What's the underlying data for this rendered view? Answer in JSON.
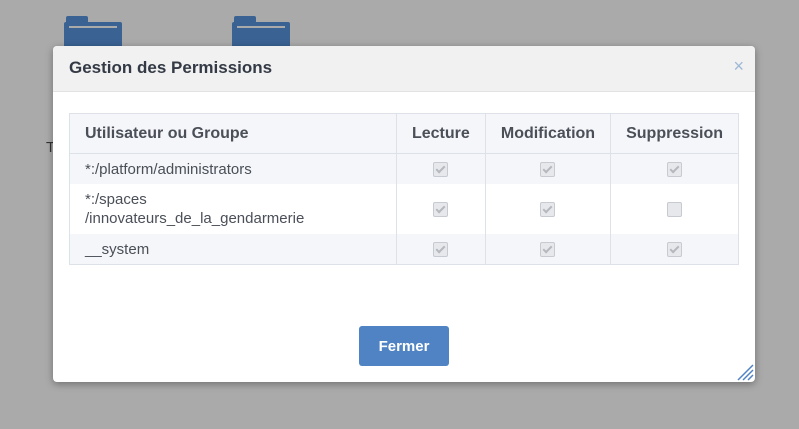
{
  "background": {
    "folders": [
      "folder-icon",
      "folder-icon"
    ],
    "partial_text": "T"
  },
  "modal": {
    "title": "Gestion des Permissions",
    "close_symbol": "×",
    "close_icon": "close-icon",
    "columns": {
      "user": "Utilisateur ou Groupe",
      "read": "Lecture",
      "modify": "Modification",
      "delete": "Suppression"
    },
    "rows": [
      {
        "name_line1": "*:/platform/administrators",
        "name_line2": "",
        "read": true,
        "modify": true,
        "delete": true
      },
      {
        "name_line1": "*:/spaces",
        "name_line2": "/innovateurs_de_la_gendarmerie",
        "read": true,
        "modify": true,
        "delete": false
      },
      {
        "name_line1": "__system",
        "name_line2": "",
        "read": true,
        "modify": true,
        "delete": true
      }
    ],
    "close_button_label": "Fermer"
  },
  "colors": {
    "primary_button": "#4f83c3",
    "folder": "#3a6293",
    "overlay": "#aaaaaa"
  }
}
